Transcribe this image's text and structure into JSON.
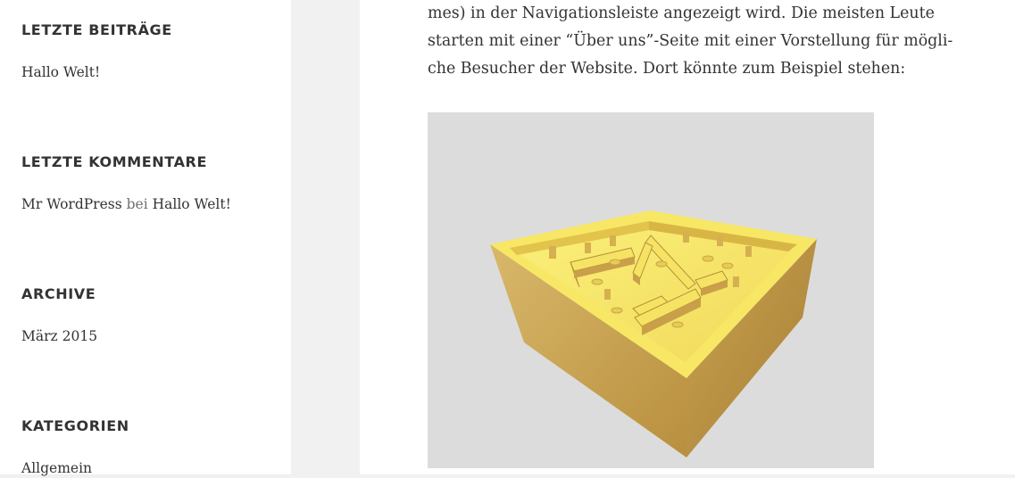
{
  "sidebar": {
    "widgets": [
      {
        "title": "LETZTE BEITRÄGE",
        "items": [
          {
            "text": "Hallo Welt!"
          }
        ]
      },
      {
        "title": "LETZTE KOMMENTARE",
        "items": [
          {
            "author": "Mr WordPress",
            "connector": "bei",
            "post": "Hallo Welt!"
          }
        ]
      },
      {
        "title": "ARCHIVE",
        "items": [
          {
            "text": "März 2015"
          }
        ]
      },
      {
        "title": "KATEGORIEN",
        "items": [
          {
            "text": "Allgemein"
          }
        ]
      }
    ]
  },
  "content": {
    "lines": [
      "mes) in der Navigationsleiste angezeigt wird. Die meisten Leute",
      "starten mit einer “Über uns”-Seite mit einer Vorstellung für mögli-",
      "che Besucher der Website. Dort könnte zum Beispiel stehen:"
    ]
  },
  "colors": {
    "sidebar_bg": "#ffffff",
    "page_bg": "#f1f1f1",
    "figure_bg": "#dcdcdc",
    "text": "#333333",
    "wood_top": "#f3e86a",
    "wood_side": "#c9a24a"
  }
}
